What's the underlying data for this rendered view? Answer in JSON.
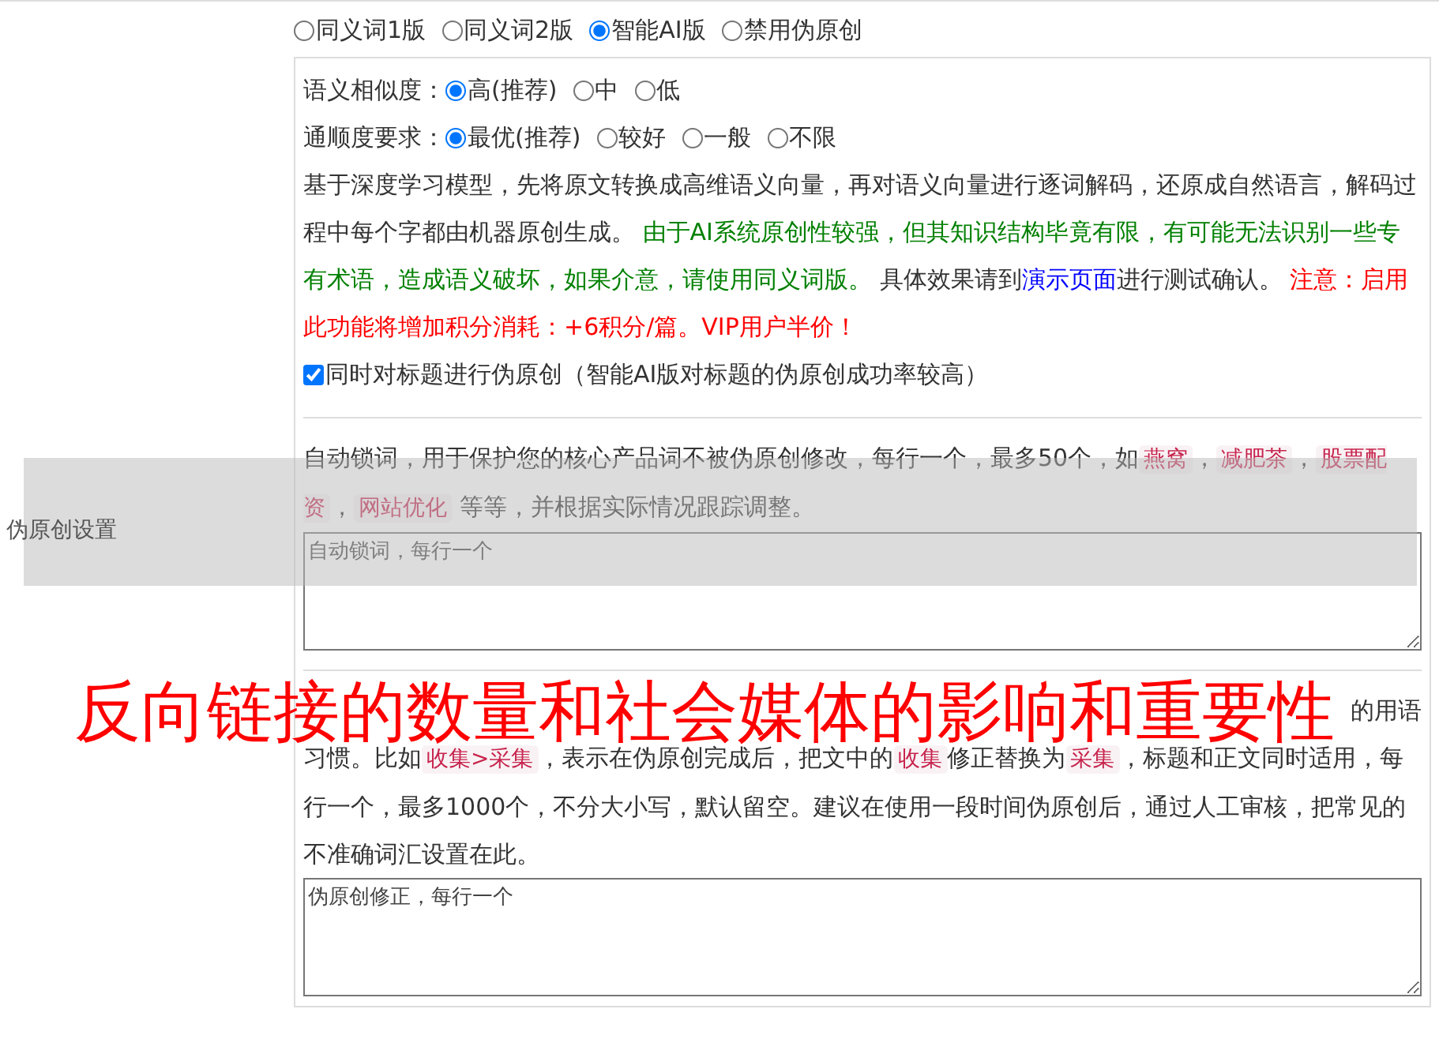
{
  "mode_options": [
    {
      "label": "同义词1版",
      "selected": false
    },
    {
      "label": "同义词2版",
      "selected": false
    },
    {
      "label": "智能AI版",
      "selected": true
    },
    {
      "label": "禁用伪原创",
      "selected": false
    }
  ],
  "row_label": "伪原创设置",
  "similarity": {
    "label": "语义相似度：",
    "options": [
      {
        "label": "高(推荐)",
        "selected": true
      },
      {
        "label": "中",
        "selected": false
      },
      {
        "label": "低",
        "selected": false
      }
    ]
  },
  "fluency": {
    "label": "通顺度要求：",
    "options": [
      {
        "label": "最优(推荐)",
        "selected": true
      },
      {
        "label": "较好",
        "selected": false
      },
      {
        "label": "一般",
        "selected": false
      },
      {
        "label": "不限",
        "selected": false
      }
    ]
  },
  "description": [
    {
      "kind": "text",
      "text": "基于深度学习模型，先将原文转换成高维语义向量，再对语义向量进行逐词解码，还原成自然语言，解码过程中每个字都由机器原创生成。 "
    },
    {
      "kind": "green",
      "text": "由于AI系统原创性较强，但其知识结构毕竟有限，有可能无法识别一些专有术语，造成语义破坏，如果介意，请使用同义词版。"
    },
    {
      "kind": "text",
      "text": " 具体效果请到"
    },
    {
      "kind": "link",
      "text": "演示页面"
    },
    {
      "kind": "text",
      "text": "进行测试确认。 "
    },
    {
      "kind": "red",
      "text": "注意：启用此功能将增加积分消耗：+6积分/篇。VIP用户半价！"
    }
  ],
  "title_checkbox": {
    "label": "同时对标题进行伪原创（智能AI版对标题的伪原创成功率较高）",
    "checked": true
  },
  "lock_words": {
    "segments": [
      {
        "kind": "text",
        "text": "自动锁词，用于保护您的核心产品词不被伪原创修改，每行一个，最多50个，如"
      },
      {
        "kind": "code",
        "text": "燕窝"
      },
      {
        "kind": "text",
        "text": "，"
      },
      {
        "kind": "code",
        "text": "减肥茶"
      },
      {
        "kind": "text",
        "text": "，"
      },
      {
        "kind": "code",
        "text": "股票配资"
      },
      {
        "kind": "text",
        "text": "，"
      },
      {
        "kind": "code",
        "text": "网站优化"
      },
      {
        "kind": "text",
        "text": " 等等，并根据实际情况跟踪调整。"
      }
    ],
    "placeholder": "自动锁词，每行一个"
  },
  "corrections": {
    "covered_line_end": "的用语",
    "segments": [
      {
        "kind": "text",
        "text": "习惯。比如"
      },
      {
        "kind": "code",
        "text": "收集>采集"
      },
      {
        "kind": "text",
        "text": "，表示在伪原创完成后，把文中的"
      },
      {
        "kind": "code",
        "text": "收集"
      },
      {
        "kind": "text",
        "text": "修正替换为"
      },
      {
        "kind": "code",
        "text": "采集"
      },
      {
        "kind": "text",
        "text": "，标题和正文同时适用，每行一个，最多1000个，不分大小写，默认留空。建议在使用一段时间伪原创后，通过人工审核，把常见的不准确词汇设置在此。"
      }
    ],
    "placeholder": "伪原创修正，每行一个"
  },
  "overlay_title": "反向链接的数量和社会媒体的影响和重要性"
}
